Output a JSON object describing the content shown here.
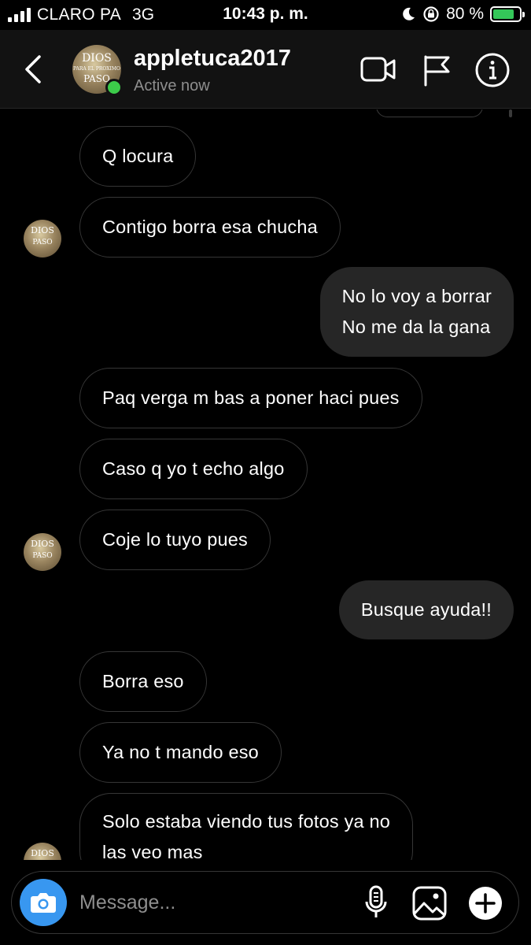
{
  "status_bar": {
    "carrier": "CLARO PA",
    "network": "3G",
    "time": "10:43 p. m.",
    "battery_percent": "80 %",
    "battery_level": 0.8,
    "icons": [
      "signal-icon",
      "moon-icon",
      "rotation-lock-icon",
      "battery-charging-icon"
    ]
  },
  "header": {
    "username": "appletuca2017",
    "status": "Active now",
    "avatar_text": [
      "DIOS",
      "PARA EL PROXIMO",
      "PASO"
    ],
    "icons": [
      "back-chevron-icon",
      "video-call-icon",
      "flag-icon",
      "info-icon"
    ]
  },
  "messages": [
    {
      "dir": "in",
      "lines": [
        "Q locura"
      ]
    },
    {
      "dir": "in",
      "lines": [
        "Contigo borra esa chucha"
      ]
    },
    {
      "dir": "out",
      "lines": [
        "No lo voy a borrar",
        "No me da la gana"
      ]
    },
    {
      "dir": "in",
      "lines": [
        "Paq verga m bas a poner haci pues"
      ]
    },
    {
      "dir": "in",
      "lines": [
        "Caso q yo t echo algo"
      ]
    },
    {
      "dir": "in",
      "lines": [
        "Coje lo tuyo pues"
      ]
    },
    {
      "dir": "out",
      "lines": [
        "Busque ayuda!!"
      ]
    },
    {
      "dir": "in",
      "lines": [
        "Borra eso"
      ]
    },
    {
      "dir": "in",
      "lines": [
        "Ya no t mando eso"
      ]
    },
    {
      "dir": "in",
      "lines": [
        "Solo estaba viendo tus fotos ya no",
        "las veo mas"
      ]
    }
  ],
  "composer": {
    "placeholder": "Message...",
    "icons": [
      "camera-icon",
      "microphone-icon",
      "gallery-icon",
      "add-icon"
    ]
  },
  "colors": {
    "background": "#000000",
    "header_bg": "#121212",
    "outgoing_bubble": "#262626",
    "incoming_border": "#363636",
    "online_dot": "#3ccb4a",
    "camera_button": "#3897f0",
    "muted_text": "#8e8e8e"
  }
}
